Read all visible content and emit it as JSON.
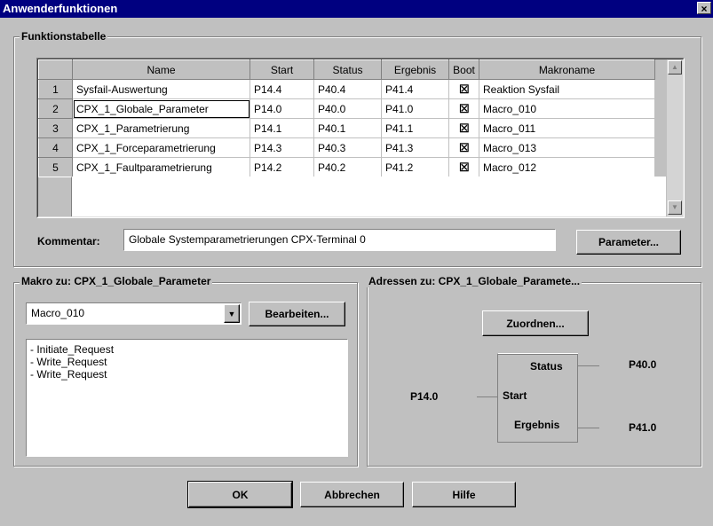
{
  "window": {
    "title": "Anwenderfunktionen",
    "close_label": "×"
  },
  "funktionstabelle": {
    "group_label": "Funktionstabelle",
    "columns": [
      "",
      "Name",
      "Start",
      "Status",
      "Ergebnis",
      "Boot",
      "Makroname"
    ],
    "rows": [
      {
        "num": "1",
        "name": "Sysfail-Auswertung",
        "start": "P14.4",
        "status": "P40.4",
        "ergebnis": "P41.4",
        "boot": "☒",
        "makro": "Reaktion Sysfail"
      },
      {
        "num": "2",
        "name": "CPX_1_Globale_Parameter",
        "start": "P14.0",
        "status": "P40.0",
        "ergebnis": "P41.0",
        "boot": "☒",
        "makro": "Macro_010"
      },
      {
        "num": "3",
        "name": "CPX_1_Parametrierung",
        "start": "P14.1",
        "status": "P40.1",
        "ergebnis": "P41.1",
        "boot": "☒",
        "makro": "Macro_011"
      },
      {
        "num": "4",
        "name": "CPX_1_Forceparametrierung",
        "start": "P14.3",
        "status": "P40.3",
        "ergebnis": "P41.3",
        "boot": "☒",
        "makro": "Macro_013"
      },
      {
        "num": "5",
        "name": "CPX_1_Faultparametrierung",
        "start": "P14.2",
        "status": "P40.2",
        "ergebnis": "P41.2",
        "boot": "☒",
        "makro": "Macro_012"
      }
    ],
    "kommentar_label": "Kommentar:",
    "kommentar_value": "Globale Systemparametrierungen CPX-Terminal 0",
    "parameter_button": "Parameter..."
  },
  "makro": {
    "group_label": "Makro zu: CPX_1_Globale_Parameter",
    "selected": "Macro_010",
    "bearbeiten_button": "Bearbeiten...",
    "lines": [
      "- Initiate_Request",
      "- Write_Request",
      "- Write_Request"
    ]
  },
  "adressen": {
    "group_label": "Adressen zu: CPX_1_Globale_Paramete...",
    "zuordnen_button": "Zuordnen...",
    "status_label": "Status",
    "status_value": "P40.0",
    "start_label": "Start",
    "start_value": "P14.0",
    "ergebnis_label": "Ergebnis",
    "ergebnis_value": "P41.0"
  },
  "footer": {
    "ok": "OK",
    "abbrechen": "Abbrechen",
    "hilfe": "Hilfe"
  },
  "colors": {
    "titlebar": "#000080",
    "face": "#c0c0c0"
  }
}
